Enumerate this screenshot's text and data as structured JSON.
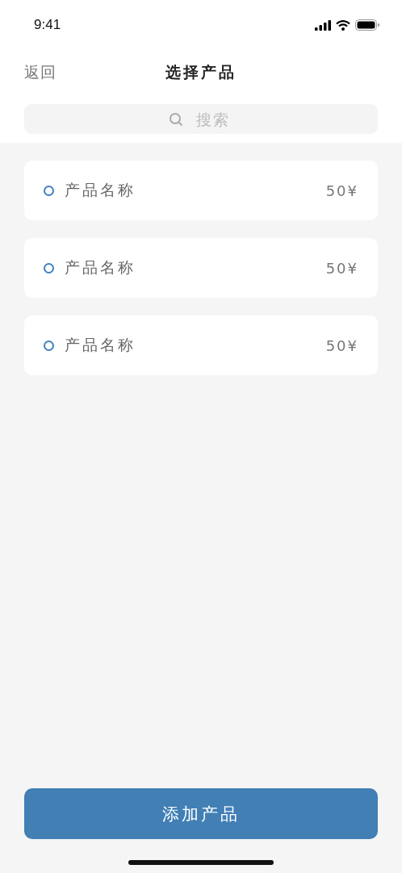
{
  "status_bar": {
    "time": "9:41"
  },
  "nav": {
    "back": "返回",
    "title": "选择产品"
  },
  "search": {
    "placeholder": "搜索"
  },
  "products": [
    {
      "name": "产品名称",
      "price": "50¥",
      "selected": false
    },
    {
      "name": "产品名称",
      "price": "50¥",
      "selected": false
    },
    {
      "name": "产品名称",
      "price": "50¥",
      "selected": false
    }
  ],
  "add_button": "添加产品"
}
